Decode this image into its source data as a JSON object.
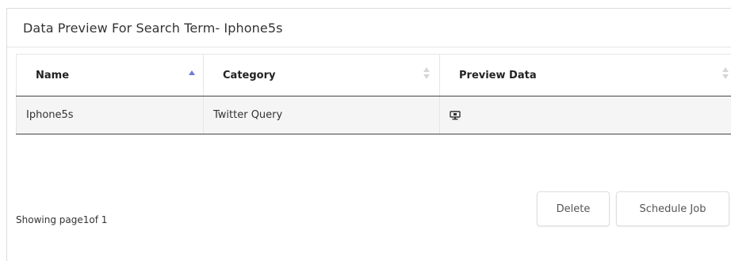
{
  "panel": {
    "title": "Data Preview For Search Term- Iphone5s"
  },
  "table": {
    "headers": {
      "name": "Name",
      "category": "Category",
      "preview": "Preview Data"
    },
    "sort": {
      "name": "ascending",
      "category": "unsorted",
      "preview": "unsorted"
    },
    "rows": [
      {
        "name": "Iphone5s",
        "category": "Twitter Query",
        "preview_icon": "monitor-icon"
      }
    ]
  },
  "pagination": {
    "text": "Showing page1of 1"
  },
  "actions": {
    "delete_label": "Delete",
    "schedule_label": "Schedule Job"
  },
  "colors": {
    "sort_active": "#6c7ae0",
    "sort_inactive": "#d6d6d6",
    "row_background": "#f5f5f5",
    "header_divider": "#444444"
  }
}
